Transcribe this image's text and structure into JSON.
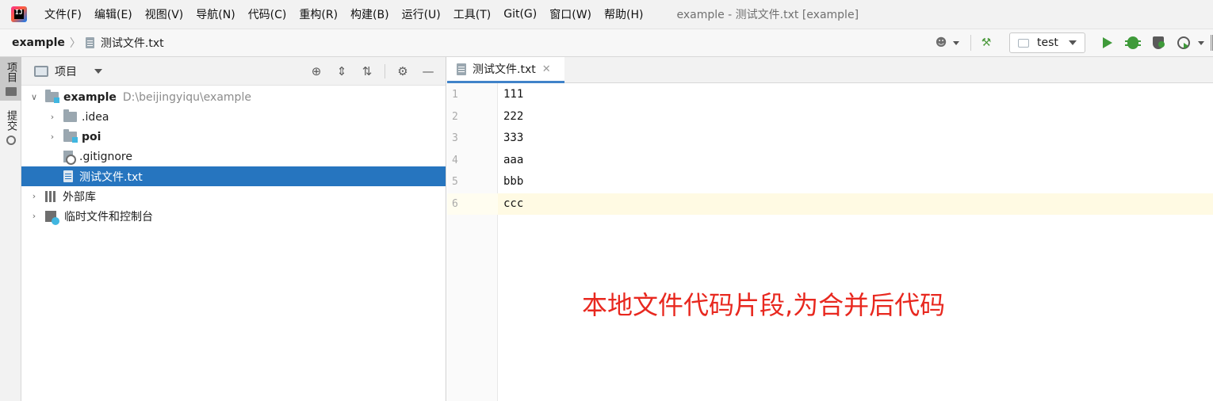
{
  "menubar": {
    "items": [
      "文件(F)",
      "编辑(E)",
      "视图(V)",
      "导航(N)",
      "代码(C)",
      "重构(R)",
      "构建(B)",
      "运行(U)",
      "工具(T)",
      "Git(G)",
      "窗口(W)",
      "帮助(H)"
    ],
    "window_title": "example - 测试文件.txt [example]",
    "logo_text": "IJ"
  },
  "navbar": {
    "project": "example",
    "file": "测试文件.txt",
    "run_config": "test"
  },
  "toolstrip": {
    "project_tab": "项目",
    "commit_tab": "提交"
  },
  "project_panel": {
    "title": "项目",
    "tree": [
      {
        "label": "example",
        "hint": "D:\\beijingyiqu\\example"
      },
      {
        "label": ".idea"
      },
      {
        "label": "poi"
      },
      {
        "label": ".gitignore"
      },
      {
        "label": "测试文件.txt"
      },
      {
        "label": "外部库"
      },
      {
        "label": "临时文件和控制台"
      }
    ]
  },
  "editor": {
    "tab_label": "测试文件.txt",
    "line_numbers": [
      "1",
      "2",
      "3",
      "4",
      "5",
      "6"
    ],
    "lines": [
      "111",
      "222",
      "333",
      "aaa",
      "bbb",
      "ccc"
    ]
  },
  "annotation": "本地文件代码片段,为合并后代码",
  "colors": {
    "selection": "#2675bf",
    "annotation": "#e8281f",
    "run_green": "#3f9a3a"
  }
}
